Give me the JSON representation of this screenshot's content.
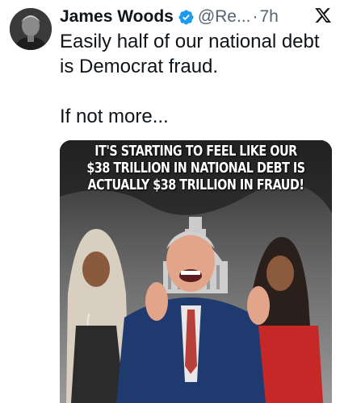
{
  "tweet": {
    "author_name": "James Woods",
    "handle": "@Re...",
    "separator": "·",
    "time": "7h",
    "text_line1": "Easily half of our national debt is Democrat fraud.",
    "text_line2": "If not more...",
    "verified_icon": "verified-badge-icon",
    "logo_icon": "x-logo-icon"
  },
  "media": {
    "caption_lines": [
      "IT'S STARTING TO FEEL LIKE OUR",
      "$38 TRILLION IN NATIONAL DEBT IS",
      "ACTUALLY $38 TRILLION IN FRAUD!"
    ]
  },
  "colors": {
    "verified_blue": "#1d9bf0",
    "secondary_text": "#536471"
  }
}
